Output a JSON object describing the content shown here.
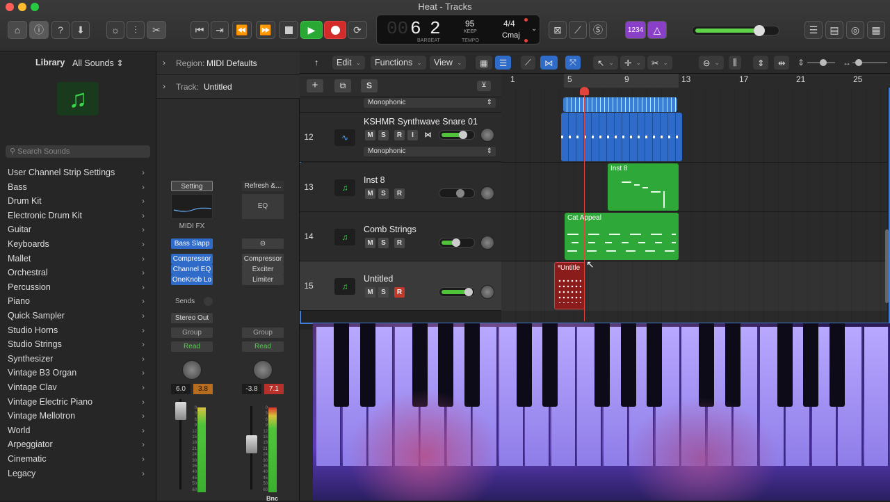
{
  "window": {
    "title": "Heat - Tracks"
  },
  "lcd": {
    "bar": "6",
    "beat": "2",
    "bar_label": "BAR",
    "beat_label": "BEAT",
    "tempo": "95",
    "keep": "KEEP",
    "tempo_label": "TEMPO",
    "signature": "4/4",
    "key": "Cmaj",
    "prefix": "00"
  },
  "controlbar": {
    "count_in": "1234"
  },
  "library": {
    "title": "Library",
    "filter": "All Sounds",
    "search_placeholder": "Search Sounds",
    "items": [
      "User Channel Strip Settings",
      "Bass",
      "Drum Kit",
      "Electronic Drum Kit",
      "Guitar",
      "Keyboards",
      "Mallet",
      "Orchestral",
      "Percussion",
      "Piano",
      "Quick Sampler",
      "Studio Horns",
      "Studio Strings",
      "Synthesizer",
      "Vintage B3 Organ",
      "Vintage Clav",
      "Vintage Electric Piano",
      "Vintage Mellotron",
      "World",
      "Arpeggiator",
      "Cinematic",
      "Legacy"
    ]
  },
  "inspector": {
    "region_label": "Region:",
    "region_value": "MIDI Defaults",
    "track_label": "Track:",
    "track_value": "Untitled",
    "strip1": {
      "setting": "Setting",
      "midi_fx": "MIDI FX",
      "instrument": "Bass Slapp",
      "plugins": [
        "Compressor",
        "Channel EQ",
        "OneKnob Lo"
      ],
      "sends": "Sends",
      "output": "Stereo Out",
      "group": "Group",
      "automation": "Read",
      "vol": "6.0",
      "peak": "3.8"
    },
    "strip2": {
      "setting": "Refresh &...",
      "eq": "EQ",
      "plugins": [
        "Compressor",
        "Exciter",
        "Limiter"
      ],
      "group": "Group",
      "automation": "Read",
      "vol": "-3.8",
      "peak": "7.1",
      "bounce": "Bnc"
    },
    "meter_scale": [
      "0",
      "3",
      "6",
      "9",
      "12",
      "15",
      "18",
      "21",
      "24",
      "30",
      "35",
      "40",
      "45",
      "50",
      "60"
    ]
  },
  "tracks_menu": {
    "edit": "Edit",
    "functions": "Functions",
    "view": "View"
  },
  "ruler": {
    "marks": [
      "1",
      "5",
      "9",
      "13",
      "17",
      "21",
      "25"
    ]
  },
  "tracks": [
    {
      "num": "",
      "name": "",
      "mode": "Monophonic"
    },
    {
      "num": "12",
      "name": "KSHMR Synthwave Snare 01",
      "mode": "Monophonic",
      "m": "M",
      "s": "S",
      "r": "R",
      "i": "I"
    },
    {
      "num": "13",
      "name": "Inst 8",
      "m": "M",
      "s": "S",
      "r": "R"
    },
    {
      "num": "14",
      "name": "Comb Strings",
      "m": "M",
      "s": "S",
      "r": "R"
    },
    {
      "num": "15",
      "name": "Untitled",
      "m": "M",
      "s": "S",
      "r": "R"
    }
  ],
  "regions": {
    "inst8": "Inst 8",
    "cat_appeal": "Cat Appeal",
    "untitled": "*Untitle"
  },
  "colors": {
    "accent_blue": "#2f6bc9",
    "region_green": "#2fa83a",
    "region_blue": "#2f6bc9",
    "region_red": "#8a1c1c",
    "play_green": "#29a834",
    "record_red": "#d32a2a"
  }
}
